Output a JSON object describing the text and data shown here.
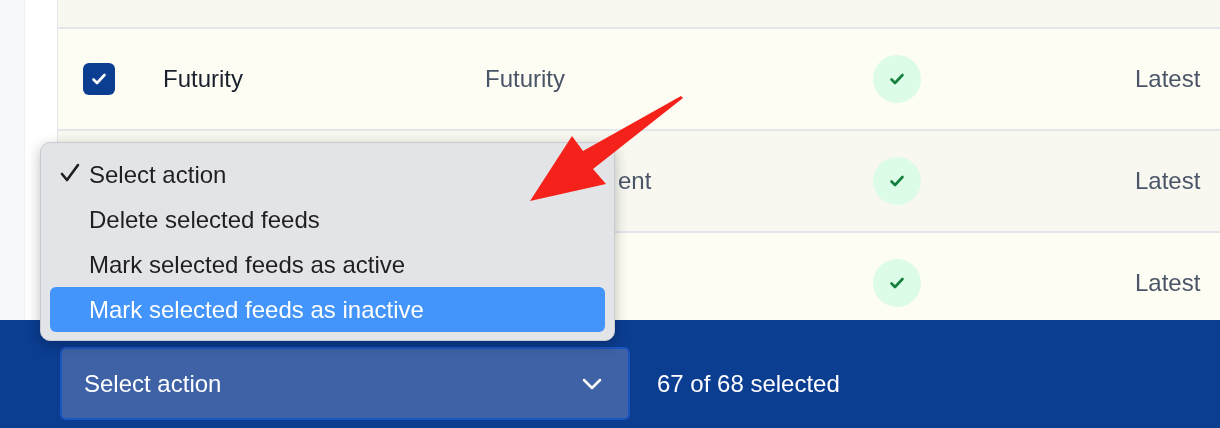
{
  "table": {
    "rows": [
      {
        "checked": true,
        "name": "Futurity",
        "source": "Futurity",
        "source_clipped": false,
        "active": true,
        "column_4": "Latest"
      },
      {
        "source": "ent",
        "source_clipped": true,
        "active": true,
        "column_4": "Latest"
      },
      {
        "active": true,
        "column_4": "Latest"
      }
    ]
  },
  "action_menu": {
    "items": [
      {
        "label": "Select action",
        "checked": true,
        "highlighted": false
      },
      {
        "label": "Delete selected feeds",
        "checked": false,
        "highlighted": false
      },
      {
        "label": "Mark selected feeds as active",
        "checked": false,
        "highlighted": false
      },
      {
        "label": "Mark selected feeds as inactive",
        "checked": false,
        "highlighted": true
      }
    ]
  },
  "bulk_bar": {
    "select": {
      "value": "Select action"
    },
    "count": "67 of 68 selected"
  }
}
